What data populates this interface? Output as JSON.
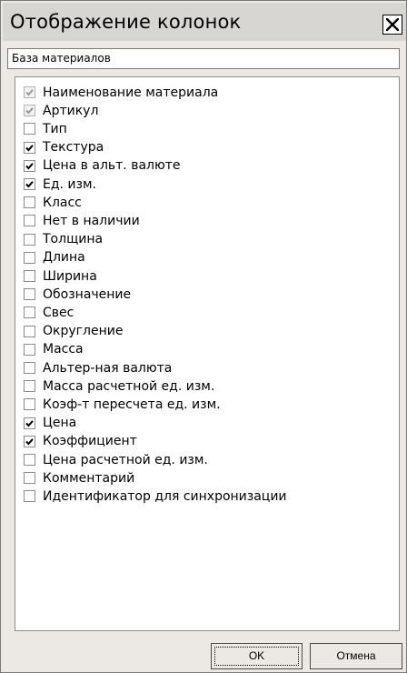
{
  "dialog": {
    "title": "Отображение колонок",
    "close_icon": "close-icon"
  },
  "source": {
    "value": "База материалов"
  },
  "columns": [
    {
      "label": "Наименование материала",
      "checked": true,
      "disabled": true
    },
    {
      "label": "Артикул",
      "checked": true,
      "disabled": true
    },
    {
      "label": "Тип",
      "checked": false,
      "disabled": false
    },
    {
      "label": "Текстура",
      "checked": true,
      "disabled": false
    },
    {
      "label": "Цена в альт. валюте",
      "checked": true,
      "disabled": false
    },
    {
      "label": "Ед. изм.",
      "checked": true,
      "disabled": false
    },
    {
      "label": "Класс",
      "checked": false,
      "disabled": false
    },
    {
      "label": "Нет в наличии",
      "checked": false,
      "disabled": false
    },
    {
      "label": "Толщина",
      "checked": false,
      "disabled": false
    },
    {
      "label": "Длина",
      "checked": false,
      "disabled": false
    },
    {
      "label": "Ширина",
      "checked": false,
      "disabled": false
    },
    {
      "label": "Обозначение",
      "checked": false,
      "disabled": false
    },
    {
      "label": "Свес",
      "checked": false,
      "disabled": false
    },
    {
      "label": "Округление",
      "checked": false,
      "disabled": false
    },
    {
      "label": "Масса",
      "checked": false,
      "disabled": false
    },
    {
      "label": "Альтер-ная валюта",
      "checked": false,
      "disabled": false
    },
    {
      "label": "Масса расчетной ед. изм.",
      "checked": false,
      "disabled": false
    },
    {
      "label": "Коэф-т пересчета ед. изм.",
      "checked": false,
      "disabled": false
    },
    {
      "label": "Цена",
      "checked": true,
      "disabled": false
    },
    {
      "label": "Коэффициент",
      "checked": true,
      "disabled": false
    },
    {
      "label": "Цена расчетной ед. изм.",
      "checked": false,
      "disabled": false
    },
    {
      "label": "Комментарий",
      "checked": false,
      "disabled": false
    },
    {
      "label": "Идентификатор для синхронизации",
      "checked": false,
      "disabled": false
    }
  ],
  "buttons": {
    "ok_label": "OK",
    "cancel_label": "Отмена"
  },
  "colors": {
    "dialog_bg": "#ece9e4",
    "title_bg": "#d7d6d3",
    "check_enabled": "#000000",
    "check_disabled": "#9a9a9a"
  }
}
